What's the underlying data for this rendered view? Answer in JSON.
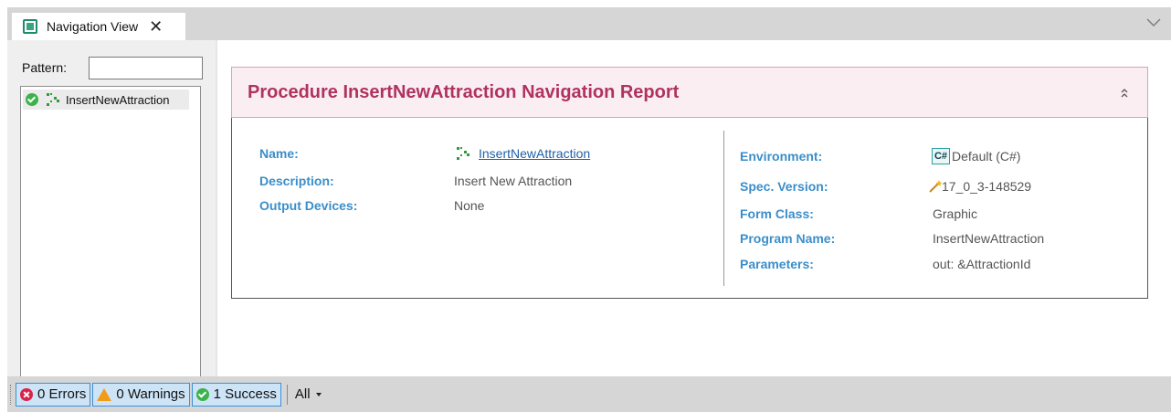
{
  "tabs": [
    {
      "label": "Navigation View",
      "close_glyph": "✕",
      "icon": "navigation-view-icon"
    }
  ],
  "left_panel": {
    "pattern_label": "Pattern:",
    "pattern_value": "",
    "tree_items": [
      {
        "label": "InsertNewAttraction",
        "status_icon": "success-check-icon",
        "type_icon": "procedure-icon"
      }
    ]
  },
  "report": {
    "title": "Procedure InsertNewAttraction Navigation Report",
    "left_fields": {
      "name_label": "Name:",
      "name_value": "InsertNewAttraction",
      "description_label": "Description:",
      "description_value": "Insert New Attraction",
      "output_devices_label": "Output Devices:",
      "output_devices_value": "None"
    },
    "right_fields": {
      "environment_label": "Environment:",
      "environment_badge": "C#",
      "environment_value": "Default (C#)",
      "spec_version_label": "Spec. Version:",
      "spec_version_value": "17_0_3-148529",
      "form_class_label": "Form Class:",
      "form_class_value": "Graphic",
      "program_name_label": "Program Name:",
      "program_name_value": "InsertNewAttraction",
      "parameters_label": "Parameters:",
      "parameters_value": "out: &AttractionId"
    }
  },
  "status_bar": {
    "errors": "0 Errors",
    "warnings": "0 Warnings",
    "success": "1 Success",
    "filter": "All"
  },
  "colors": {
    "title": "#b0325f",
    "header_bg": "#fbeef3",
    "field_label": "#3b8ec9",
    "link": "#1f5fa8",
    "success": "#3bb34a",
    "error": "#d8244a",
    "warning": "#f29b16"
  }
}
